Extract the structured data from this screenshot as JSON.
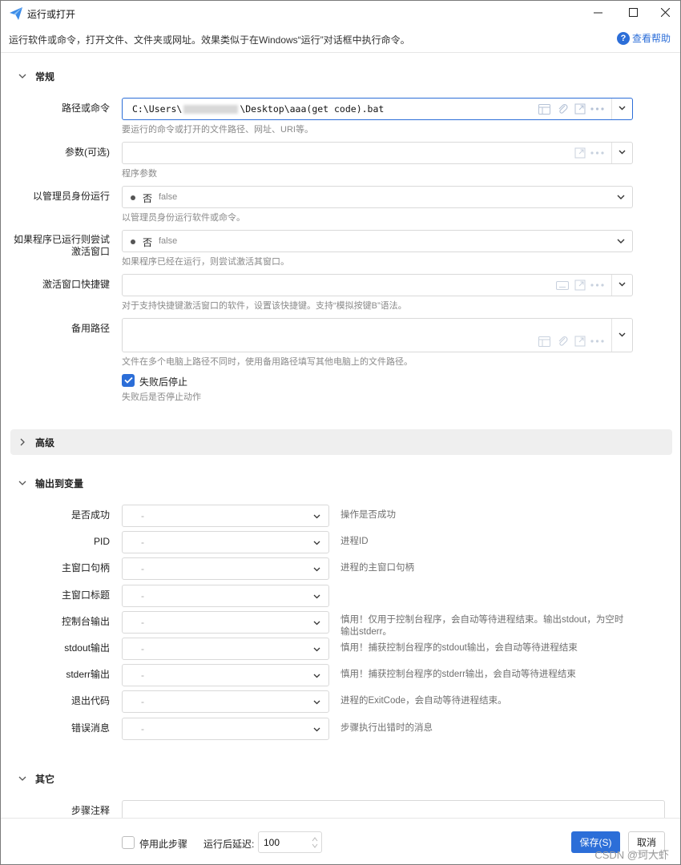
{
  "window": {
    "title": "运行或打开",
    "description": "运行软件或命令，打开文件、文件夹或网址。效果类似于在Windows“运行”对话框中执行命令。",
    "help_label": "查看帮助"
  },
  "sections": {
    "general": "常规",
    "advanced": "高级",
    "output": "输出到变量",
    "other": "其它"
  },
  "general": {
    "path": {
      "label": "路径或命令",
      "value_prefix": "C:\\Users\\",
      "value_suffix": "\\Desktop\\aaa(get code).bat",
      "hint": "要运行的命令或打开的文件路径、网址、URI等。"
    },
    "args": {
      "label": "参数(可选)",
      "value": "",
      "hint": "程序参数"
    },
    "run_as_admin": {
      "label": "以管理员身份运行",
      "value": "否",
      "sub": "false",
      "hint": "以管理员身份运行软件或命令。"
    },
    "activate_if_running": {
      "label": "如果程序已运行则尝试激活窗口",
      "value": "否",
      "sub": "false",
      "hint": "如果程序已经在运行，则尝试激活其窗口。"
    },
    "hotkey": {
      "label": "激活窗口快捷键",
      "value": "",
      "hint": "对于支持快捷键激活窗口的软件，设置该快捷键。支持“模拟按键B”语法。"
    },
    "backup_path": {
      "label": "备用路径",
      "value": "",
      "hint": "文件在多个电脑上路径不同时，使用备用路径填写其他电脑上的文件路径。"
    },
    "stop_on_fail": {
      "label": "失败后停止",
      "checked": true,
      "hint": "失败后是否停止动作"
    }
  },
  "output_vars": [
    {
      "label": "是否成功",
      "value": "-",
      "desc": "操作是否成功"
    },
    {
      "label": "PID",
      "value": "-",
      "desc": "进程ID"
    },
    {
      "label": "主窗口句柄",
      "value": "-",
      "desc": "进程的主窗口句柄"
    },
    {
      "label": "主窗口标题",
      "value": "-",
      "desc": ""
    },
    {
      "label": "控制台输出",
      "value": "-",
      "desc": "慎用！仅用于控制台程序，会自动等待进程结束。输出stdout，为空时输出stderr。"
    },
    {
      "label": "stdout输出",
      "value": "-",
      "desc": "慎用！捕获控制台程序的stdout输出，会自动等待进程结束"
    },
    {
      "label": "stderr输出",
      "value": "-",
      "desc": "慎用！捕获控制台程序的stderr输出，会自动等待进程结束"
    },
    {
      "label": "退出代码",
      "value": "-",
      "desc": "进程的ExitCode，会自动等待进程结束。"
    },
    {
      "label": "错误消息",
      "value": "-",
      "desc": "步骤执行出错时的消息"
    }
  ],
  "other": {
    "note_label": "步骤注释",
    "note_value": ""
  },
  "footer": {
    "disable_label": "停用此步骤",
    "disable_checked": false,
    "delay_label": "运行后延迟:",
    "delay_value": "100",
    "save_label": "保存(S)",
    "cancel_label": "取消"
  },
  "watermark": "CSDN @珂大虾",
  "colors": {
    "accent": "#2c6ed8",
    "border": "#d9d9d9",
    "hint": "#8a8a8a"
  }
}
